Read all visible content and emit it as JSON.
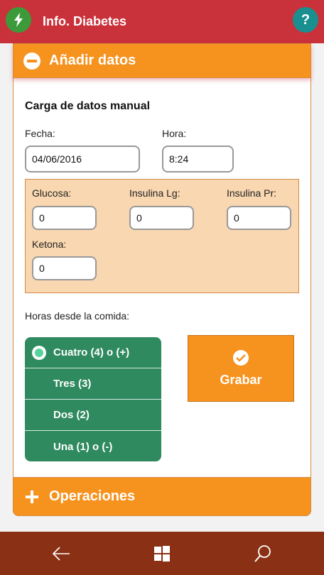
{
  "header": {
    "title": "Info. Diabetes",
    "help_label": "?"
  },
  "accordion": {
    "top_label": "Añadir datos",
    "bottom_label": "Operaciones"
  },
  "form": {
    "section_title": "Carga de datos manual",
    "fecha_label": "Fecha:",
    "fecha_value": "04/06/2016",
    "hora_label": "Hora:",
    "hora_value": "8:24",
    "glucosa_label": "Glucosa:",
    "glucosa_value": "0",
    "insulina_lg_label": "Insulina Lg:",
    "insulina_lg_value": "0",
    "insulina_pr_label": "Insulina Pr:",
    "insulina_pr_value": "0",
    "ketona_label": "Ketona:",
    "ketona_value": "0",
    "horas_label": "Horas desde la comida:"
  },
  "meal_options": [
    {
      "label": "Cuatro (4) o (+)",
      "selected": true
    },
    {
      "label": "Tres (3)",
      "selected": false
    },
    {
      "label": "Dos (2)",
      "selected": false
    },
    {
      "label": "Una (1) o (-)",
      "selected": false
    }
  ],
  "save_button": {
    "label": "Grabar"
  },
  "nav": {
    "icons": [
      "back-icon",
      "windows-icon",
      "search-icon"
    ]
  },
  "colors": {
    "header": "#c9313b",
    "accent": "#f6921e",
    "green": "#2f8a5f",
    "navbar": "#8a3015"
  }
}
